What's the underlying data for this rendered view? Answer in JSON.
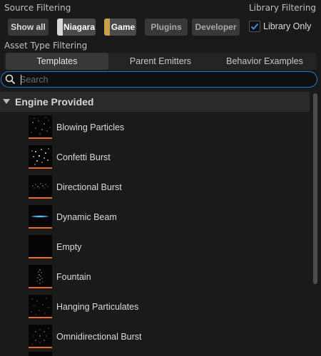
{
  "source_filtering": {
    "label": "Source Filtering",
    "buttons": [
      {
        "label": "Show all",
        "checked": false,
        "swatch": null
      },
      {
        "label": "Niagara",
        "checked": true,
        "swatch": "#d8d8d8"
      },
      {
        "label": "Game",
        "checked": true,
        "swatch": "#c8a04a"
      },
      {
        "label": "Plugins",
        "checked": false,
        "swatch": null
      },
      {
        "label": "Developer",
        "checked": false,
        "swatch": null
      }
    ]
  },
  "library_filtering": {
    "label": "Library Filtering",
    "checkbox_label": "Library Only",
    "checked": true
  },
  "asset_type_filtering": {
    "label": "Asset Type Filtering",
    "tabs": [
      {
        "label": "Templates",
        "active": true
      },
      {
        "label": "Parent Emitters",
        "active": false
      },
      {
        "label": "Behavior Examples",
        "active": false
      }
    ]
  },
  "search": {
    "placeholder": "Search",
    "value": ""
  },
  "group": {
    "label": "Engine Provided",
    "expanded": true
  },
  "items": [
    {
      "label": "Blowing Particles",
      "icon": "blowing-particles"
    },
    {
      "label": "Confetti Burst",
      "icon": "confetti-burst"
    },
    {
      "label": "Directional Burst",
      "icon": "directional-burst"
    },
    {
      "label": "Dynamic Beam",
      "icon": "dynamic-beam"
    },
    {
      "label": "Empty",
      "icon": "empty"
    },
    {
      "label": "Fountain",
      "icon": "fountain"
    },
    {
      "label": "Hanging Particulates",
      "icon": "hanging-particulates"
    },
    {
      "label": "Omnidirectional Burst",
      "icon": "omnidirectional-burst"
    }
  ],
  "colors": {
    "accent": "#1e7ad6",
    "thumbnail_underline": "#e86a2e"
  }
}
